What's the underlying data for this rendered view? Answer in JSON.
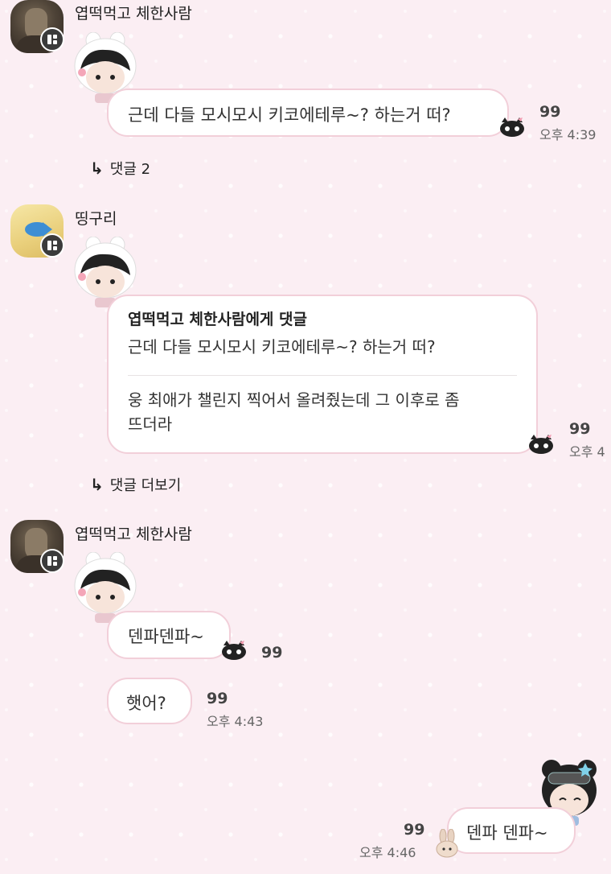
{
  "messages": [
    {
      "author": "엽떡먹고 체한사람",
      "text": "근데 다들 모시모시 키코에테루~? 하는거 떠?",
      "count": "99",
      "time": "오후 4:39",
      "replies_label": "댓글 2"
    },
    {
      "author": "띵구리",
      "quote_title": "엽떡먹고 체한사람에게 댓글",
      "quote_text": "근데 다들 모시모시 키코에테루~? 하는거 떠?",
      "reply_text_line1": "웅 최애가 챌린지 찍어서 올려줬는데 그 이후로 좀",
      "reply_text_line2": "뜨더라",
      "count": "99",
      "time": "오후 4",
      "more_replies_label": "댓글 더보기"
    },
    {
      "author": "엽떡먹고 체한사람",
      "text1": "덴파덴파~",
      "count1": "99",
      "text2": "햇어?",
      "count2": "99",
      "time2": "오후 4:43"
    },
    {
      "text": "덴파 덴파~",
      "count": "99",
      "time": "오후 4:46"
    }
  ]
}
